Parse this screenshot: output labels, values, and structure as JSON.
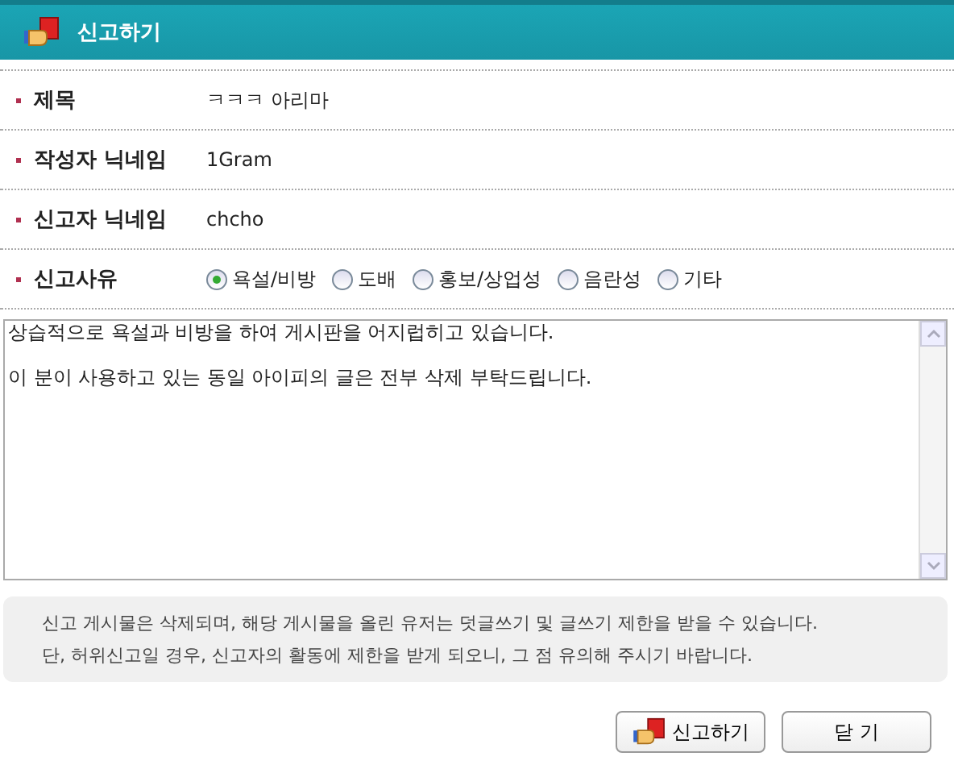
{
  "window": {
    "title": "신고하기"
  },
  "fields": [
    {
      "label": "제목",
      "value": "ㅋㅋㅋ 아리마"
    },
    {
      "label": "작성자 닉네임",
      "value": "1Gram"
    },
    {
      "label": "신고자 닉네임",
      "value": "chcho"
    }
  ],
  "reason": {
    "label": "신고사유",
    "options": [
      {
        "label": "욕설/비방",
        "selected": true
      },
      {
        "label": "도배",
        "selected": false
      },
      {
        "label": "홍보/상업성",
        "selected": false
      },
      {
        "label": "음란성",
        "selected": false
      },
      {
        "label": "기타",
        "selected": false
      }
    ]
  },
  "details": {
    "value": "상습적으로 욕설과 비방을 하여 게시판을 어지럽히고 있습니다.\n\n이 분이 사용하고 있는 동일 아이피의 글은 전부 삭제 부탁드립니다."
  },
  "notice": [
    "신고 게시물은 삭제되며, 해당 게시물을 올린 유저는 덧글쓰기 및 글쓰기 제한을 받을 수 있습니다.",
    "단, 허위신고일 경우, 신고자의 활동에 제한을 받게 되오니, 그 점 유의해 주시기 바랍니다."
  ],
  "buttons": [
    {
      "label": "신고하기",
      "kind": "report"
    },
    {
      "label": "닫 기",
      "kind": "close"
    }
  ]
}
